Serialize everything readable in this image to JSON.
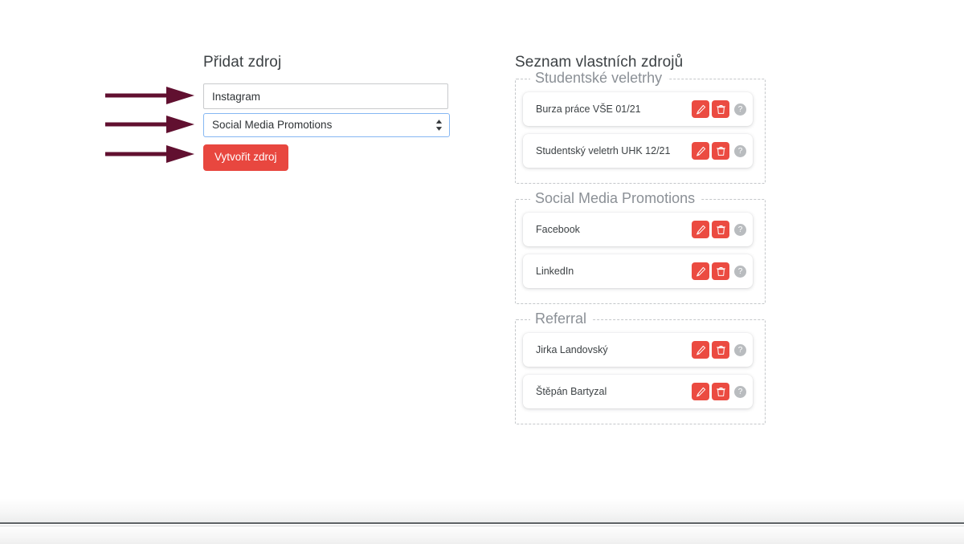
{
  "form": {
    "title": "Přidat zdroj",
    "name_input": {
      "value": "Instagram",
      "placeholder": "Instagram"
    },
    "category_select": {
      "selected": "Social Media Promotions",
      "options": [
        "Studentské veletrhy",
        "Social Media Promotions",
        "Referral"
      ],
      "icon": "chevron-up-down-icon"
    },
    "submit_label": "Vytvořit zdroj"
  },
  "annotations": {
    "arrow_color": "#611030",
    "arrows": [
      "arrow-to-name-input",
      "arrow-to-category-select",
      "arrow-to-create-button"
    ]
  },
  "list": {
    "title": "Seznam vlastních zdrojů",
    "row_actions": {
      "edit_icon": "pencil-icon",
      "delete_icon": "trash-icon",
      "help_icon": "question-circle-icon",
      "help_label": "?"
    },
    "groups": [
      {
        "legend": "Studentské veletrhy",
        "items": [
          {
            "label": "Burza práce VŠE 01/21"
          },
          {
            "label": "Studentský veletrh UHK 12/21"
          }
        ]
      },
      {
        "legend": "Social Media Promotions",
        "items": [
          {
            "label": "Facebook"
          },
          {
            "label": "LinkedIn"
          }
        ]
      },
      {
        "legend": "Referral",
        "items": [
          {
            "label": "Jirka Landovský"
          },
          {
            "label": "Štěpán Bartyzal"
          }
        ]
      }
    ]
  },
  "colors": {
    "accent_red": "#e8473f",
    "action_red": "#eb4b41",
    "arrow_maroon": "#611030",
    "focus_blue": "#86b7f2",
    "legend_gray": "#8b9096",
    "text_dark": "#3c4144",
    "help_gray": "#b9bcbf"
  }
}
